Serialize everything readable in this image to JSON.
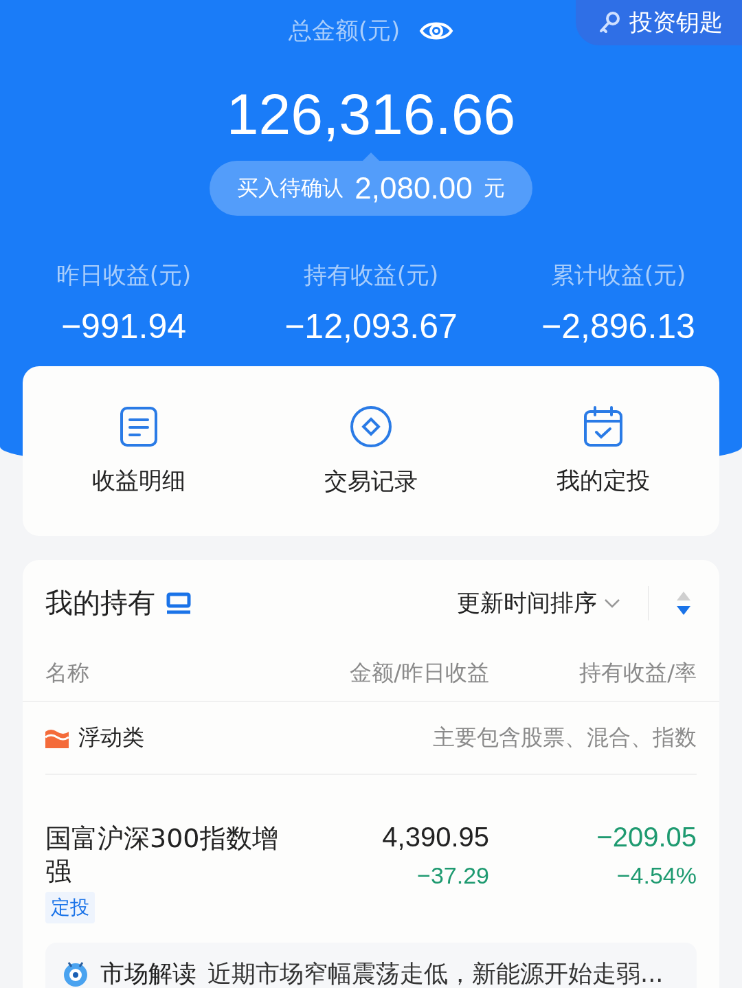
{
  "header": {
    "key_button": "投资钥匙",
    "total_label": "总金额(元)",
    "total": "126,316.66",
    "pending": {
      "label": "买入待确认",
      "amount": "2,080.00",
      "unit": "元"
    }
  },
  "stats": [
    {
      "label": "昨日收益(元)",
      "value": "−991.94"
    },
    {
      "label": "持有收益(元)",
      "value": "−12,093.67"
    },
    {
      "label": "累计收益(元)",
      "value": "−2,896.13"
    }
  ],
  "shortcuts": [
    {
      "label": "收益明细",
      "kind": "document"
    },
    {
      "label": "交易记录",
      "kind": "diamond"
    },
    {
      "label": "我的定投",
      "kind": "calendar"
    }
  ],
  "holdings": {
    "title": "我的持有",
    "sort": "更新时间排序",
    "columns": [
      "名称",
      "金额/昨日收益",
      "持有收益/率"
    ],
    "category": {
      "name": "浮动类",
      "note": "主要包含股票、混合、指数"
    },
    "funds": [
      {
        "name": "国富沪深300指数增强",
        "tag": "定投",
        "amount": "4,390.95",
        "yesterday": "−37.29",
        "profit": "−209.05",
        "rate": "−4.54%"
      }
    ],
    "insight": {
      "title": "市场解读",
      "text": "近期市场窄幅震荡走低，新能源开始走弱..."
    }
  }
}
